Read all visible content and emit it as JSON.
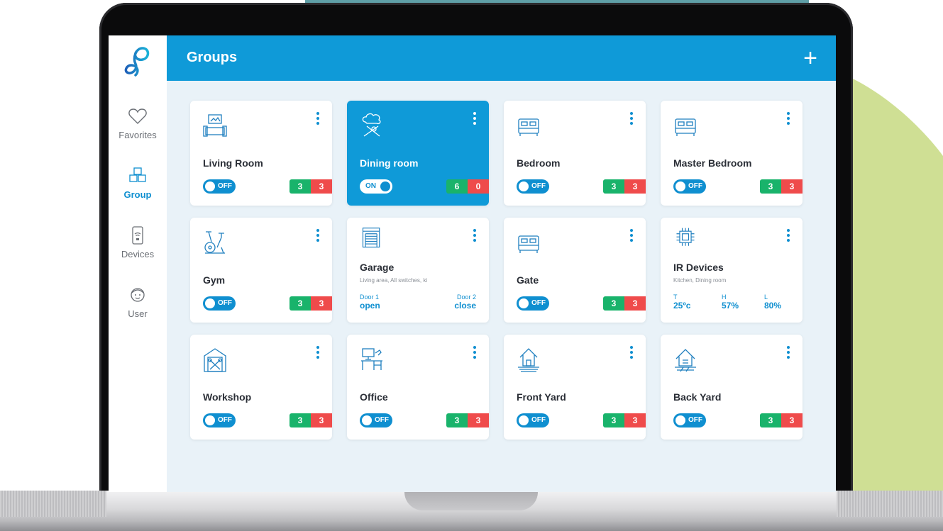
{
  "app": {
    "title": "Groups",
    "add_symbol": "+"
  },
  "nav": [
    {
      "label": "Favorites",
      "icon": "heart-icon",
      "active": false
    },
    {
      "label": "Group",
      "icon": "cubes-icon",
      "active": true
    },
    {
      "label": "Devices",
      "icon": "switch-icon",
      "active": false
    },
    {
      "label": "User",
      "icon": "user-icon",
      "active": false
    }
  ],
  "colors": {
    "accent": "#0f9ad8",
    "on_count": "#19b36b",
    "off_count": "#ef4b4b",
    "background": "#e9f2f8"
  },
  "cards": [
    {
      "title": "Living Room",
      "icon": "sofa-icon",
      "toggle": "OFF",
      "on": "3",
      "off": "3"
    },
    {
      "title": "Dining room",
      "icon": "chef-hat-icon",
      "toggle": "ON",
      "on": "6",
      "off": "0"
    },
    {
      "title": "Bedroom",
      "icon": "bed-icon",
      "toggle": "OFF",
      "on": "3",
      "off": "3"
    },
    {
      "title": "Master Bedroom",
      "icon": "bed-icon",
      "toggle": "OFF",
      "on": "3",
      "off": "3"
    },
    {
      "title": "Gym",
      "icon": "exercise-bike-icon",
      "toggle": "OFF",
      "on": "3",
      "off": "3"
    },
    {
      "title": "Garage",
      "icon": "garage-door-icon",
      "subtitle": "Living area, All switches, ki",
      "door1_label": "Door 1",
      "door1_value": "open",
      "door2_label": "Door 2",
      "door2_value": "close"
    },
    {
      "title": "Gate",
      "icon": "bed-icon",
      "toggle": "OFF",
      "on": "3",
      "off": "3"
    },
    {
      "title": "IR Devices",
      "icon": "chip-icon",
      "subtitle": "Kitchen, Dining room",
      "t_label": "T",
      "t_value": "25ºc",
      "h_label": "H",
      "h_value": "57%",
      "l_label": "L",
      "l_value": "80%"
    },
    {
      "title": "Workshop",
      "icon": "workshop-icon",
      "toggle": "OFF",
      "on": "3",
      "off": "3"
    },
    {
      "title": "Office",
      "icon": "desk-icon",
      "toggle": "OFF",
      "on": "3",
      "off": "3"
    },
    {
      "title": "Front Yard",
      "icon": "front-yard-icon",
      "toggle": "OFF",
      "on": "3",
      "off": "3"
    },
    {
      "title": "Back Yard",
      "icon": "back-yard-icon",
      "toggle": "OFF",
      "on": "3",
      "off": "3"
    }
  ]
}
